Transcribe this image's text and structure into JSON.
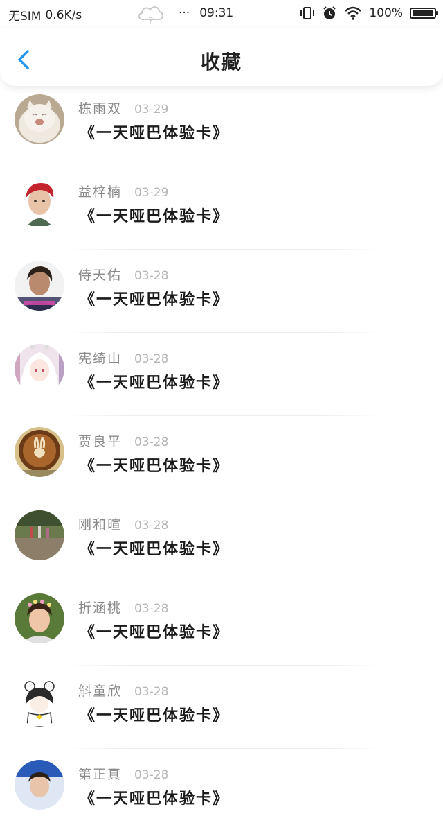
{
  "status_bar": {
    "carrier": "无SIM",
    "speed": "0.6K/s",
    "dots": "···",
    "time": "09:31",
    "battery": "100%"
  },
  "header": {
    "title": "收藏"
  },
  "items": [
    {
      "user": "栋雨双",
      "date": "03-29",
      "title": "《一天哑巴体验卡》"
    },
    {
      "user": "益梓楠",
      "date": "03-29",
      "title": "《一天哑巴体验卡》"
    },
    {
      "user": "侍天佑",
      "date": "03-28",
      "title": "《一天哑巴体验卡》"
    },
    {
      "user": "宪绮山",
      "date": "03-28",
      "title": "《一天哑巴体验卡》"
    },
    {
      "user": "贾良平",
      "date": "03-28",
      "title": "《一天哑巴体验卡》"
    },
    {
      "user": "刚和暄",
      "date": "03-28",
      "title": "《一天哑巴体验卡》"
    },
    {
      "user": "折涵桃",
      "date": "03-28",
      "title": "《一天哑巴体验卡》"
    },
    {
      "user": "斛童欣",
      "date": "03-28",
      "title": "《一天哑巴体验卡》"
    },
    {
      "user": "第正真",
      "date": "03-28",
      "title": "《一天哑巴体验卡》"
    }
  ],
  "icons": {
    "back": "chevron-left-icon",
    "cloud": "cloud-question-icon",
    "vibrate": "vibrate-icon",
    "alarm": "alarm-icon",
    "wifi": "wifi-icon",
    "battery": "battery-icon"
  },
  "colors": {
    "accent": "#2196f3",
    "username": "#8a8a8a",
    "date": "#b5b5b5",
    "title": "#1a1a1a"
  }
}
